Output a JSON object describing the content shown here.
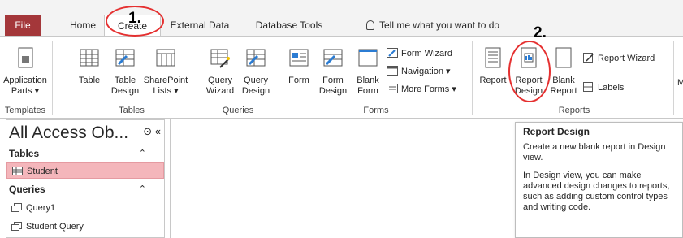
{
  "tabs": {
    "file": "File",
    "home": "Home",
    "create": "Create",
    "external": "External Data",
    "dbtools": "Database Tools",
    "tell": "Tell me what you want to do"
  },
  "ribbon": {
    "templates": {
      "app_parts_1": "Application",
      "app_parts_2": "Parts ▾",
      "label": "Templates"
    },
    "tables": {
      "table": "Table",
      "design_1": "Table",
      "design_2": "Design",
      "sp_1": "SharePoint",
      "sp_2": "Lists ▾",
      "label": "Tables"
    },
    "queries": {
      "wiz_1": "Query",
      "wiz_2": "Wizard",
      "des_1": "Query",
      "des_2": "Design",
      "label": "Queries"
    },
    "forms": {
      "form": "Form",
      "fdes_1": "Form",
      "fdes_2": "Design",
      "blank_1": "Blank",
      "blank_2": "Form",
      "wizard": "Form Wizard",
      "navigation": "Navigation ▾",
      "more": "More Forms ▾",
      "label": "Forms"
    },
    "reports": {
      "report": "Report",
      "rdes_1": "Report",
      "rdes_2": "Design",
      "blank_1": "Blank",
      "blank_2": "Report",
      "wizard": "Report Wizard",
      "labels": "Labels",
      "label": "Reports"
    },
    "cut_label": "M"
  },
  "nav": {
    "title": "All Access Ob...",
    "controls": "⊙ «",
    "tables_header": "Tables",
    "tables_items": [
      "Student"
    ],
    "queries_header": "Queries",
    "queries_items": [
      "Query1",
      "Student Query"
    ],
    "chevron": "⌃"
  },
  "tooltip": {
    "title": "Report Design",
    "p1": "Create a new blank report in Design view.",
    "p2": "In Design view, you can make advanced design changes to reports, such as adding custom control types and writing code."
  },
  "annotations": {
    "one": "1.",
    "two": "2."
  },
  "colors": {
    "file_tab": "#a4373a",
    "selection": "#f4b6bb",
    "annotation_circle": "#e53030"
  }
}
